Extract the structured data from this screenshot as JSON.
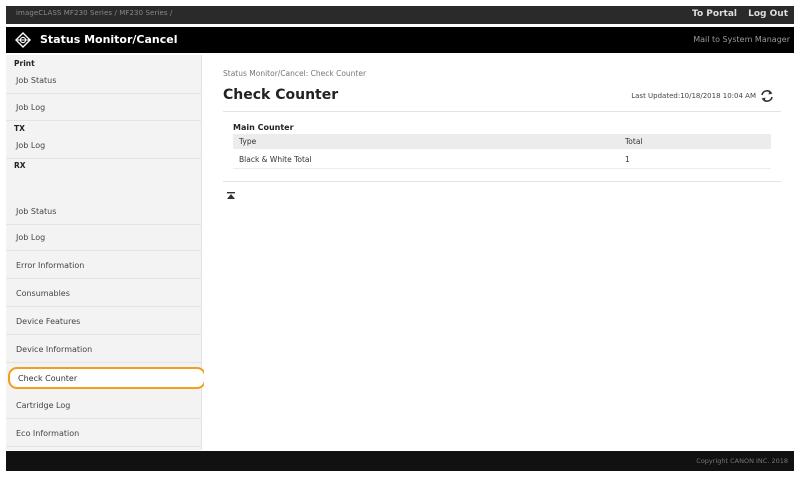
{
  "topbar": {
    "crumbs": "imageCLASS    MF230 Series / MF230 Series /",
    "portal_label": "To Portal",
    "logout_label": "Log Out"
  },
  "header": {
    "title": "Status Monitor/Cancel",
    "mail_label": "Mail to System Manager"
  },
  "sidebar": {
    "sections": [
      {
        "title": "Print",
        "items": [
          "Job Status",
          "Job Log"
        ]
      },
      {
        "title": "TX",
        "items": [
          "Job Log"
        ]
      },
      {
        "title": "RX",
        "items": [
          "Job Status",
          "Job Log"
        ]
      }
    ],
    "other_items": [
      "Error Information",
      "Consumables",
      "Device Features",
      "Device Information",
      "Check Counter",
      "Cartridge Log",
      "Eco Information"
    ],
    "active_item": "Check Counter"
  },
  "main": {
    "breadcrumb": "Status Monitor/Cancel: Check Counter",
    "title": "Check Counter",
    "last_updated": "Last Updated:10/18/2018 10:04 AM",
    "section_title": "Main Counter",
    "table": {
      "headers": [
        "Type",
        "Total"
      ],
      "rows": [
        [
          "Black & White Total",
          "1"
        ]
      ]
    }
  },
  "footer": {
    "copyright": "Copyright CANON INC. 2018"
  },
  "colors": {
    "highlight": "#f0a020",
    "topbar": "#2a2a2a",
    "titlebar": "#000000",
    "sidebar_bg": "#f3f3f3"
  }
}
